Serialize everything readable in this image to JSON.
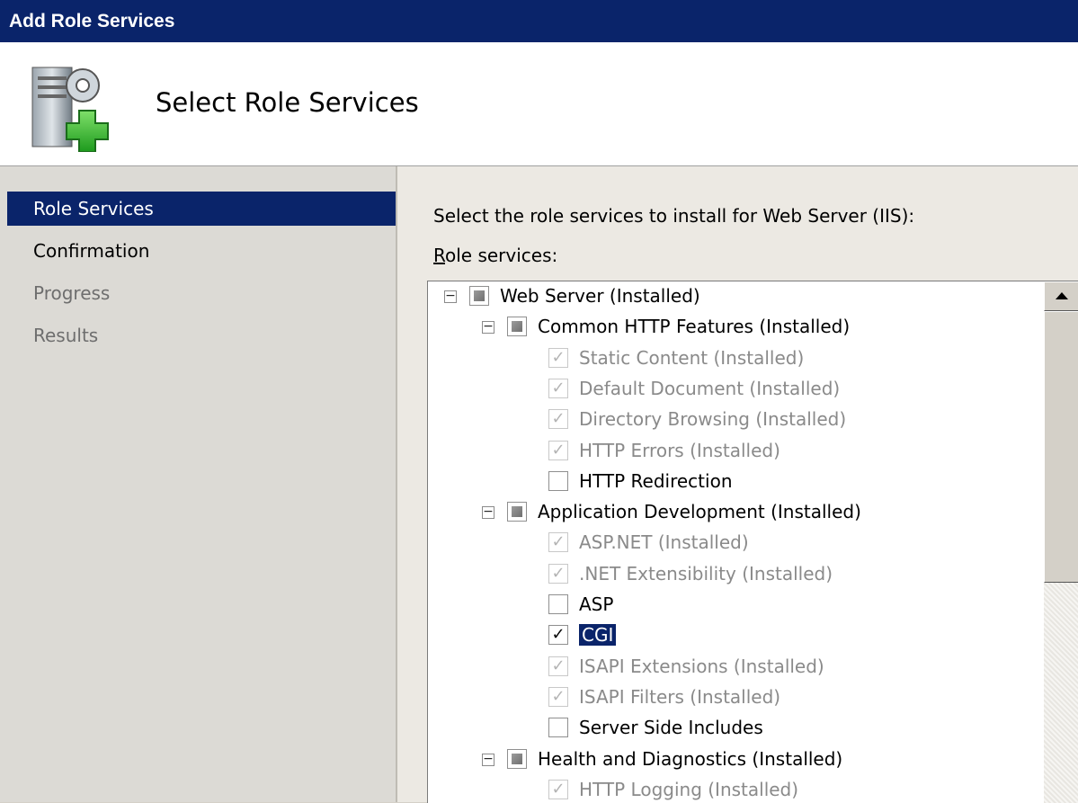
{
  "window": {
    "title": "Add Role Services"
  },
  "header": {
    "heading": "Select Role Services"
  },
  "nav": {
    "items": [
      {
        "label": "Role Services",
        "state": "active"
      },
      {
        "label": "Confirmation",
        "state": "normal"
      },
      {
        "label": "Progress",
        "state": "disabled"
      },
      {
        "label": "Results",
        "state": "disabled"
      }
    ]
  },
  "content": {
    "instruction": "Select the role services to install for Web Server (IIS):",
    "role_services_label_accel": "R",
    "role_services_label_rest": "ole services:"
  },
  "tree": {
    "rows": [
      {
        "label": "Web Server  (Installed)",
        "level": 0,
        "expander": "−",
        "check": "tri",
        "dim": false
      },
      {
        "label": "Common HTTP Features  (Installed)",
        "level": 1,
        "expander": "−",
        "check": "tri",
        "dim": false
      },
      {
        "label": "Static Content  (Installed)",
        "level": 2,
        "check": "checked-disabled",
        "dim": true
      },
      {
        "label": "Default Document  (Installed)",
        "level": 2,
        "check": "checked-disabled",
        "dim": true
      },
      {
        "label": "Directory Browsing  (Installed)",
        "level": 2,
        "check": "checked-disabled",
        "dim": true
      },
      {
        "label": "HTTP Errors  (Installed)",
        "level": 2,
        "check": "checked-disabled",
        "dim": true
      },
      {
        "label": "HTTP Redirection",
        "level": 2,
        "check": "unchecked",
        "dim": false
      },
      {
        "label": "Application Development  (Installed)",
        "level": 1,
        "expander": "−",
        "check": "tri",
        "dim": false
      },
      {
        "label": "ASP.NET  (Installed)",
        "level": 2,
        "check": "checked-disabled",
        "dim": true
      },
      {
        "label": ".NET Extensibility  (Installed)",
        "level": 2,
        "check": "checked-disabled",
        "dim": true
      },
      {
        "label": "ASP",
        "level": 2,
        "check": "unchecked",
        "dim": false
      },
      {
        "label": "CGI",
        "level": 2,
        "check": "checked",
        "dim": false,
        "selected": true
      },
      {
        "label": "ISAPI Extensions  (Installed)",
        "level": 2,
        "check": "checked-disabled",
        "dim": true
      },
      {
        "label": "ISAPI Filters  (Installed)",
        "level": 2,
        "check": "checked-disabled",
        "dim": true
      },
      {
        "label": "Server Side Includes",
        "level": 2,
        "check": "unchecked",
        "dim": false
      },
      {
        "label": "Health and Diagnostics  (Installed)",
        "level": 1,
        "expander": "−",
        "check": "tri",
        "dim": false
      },
      {
        "label": "HTTP Logging  (Installed)",
        "level": 2,
        "check": "checked-disabled",
        "dim": true
      }
    ]
  },
  "glyphs": {
    "check": "✓"
  }
}
